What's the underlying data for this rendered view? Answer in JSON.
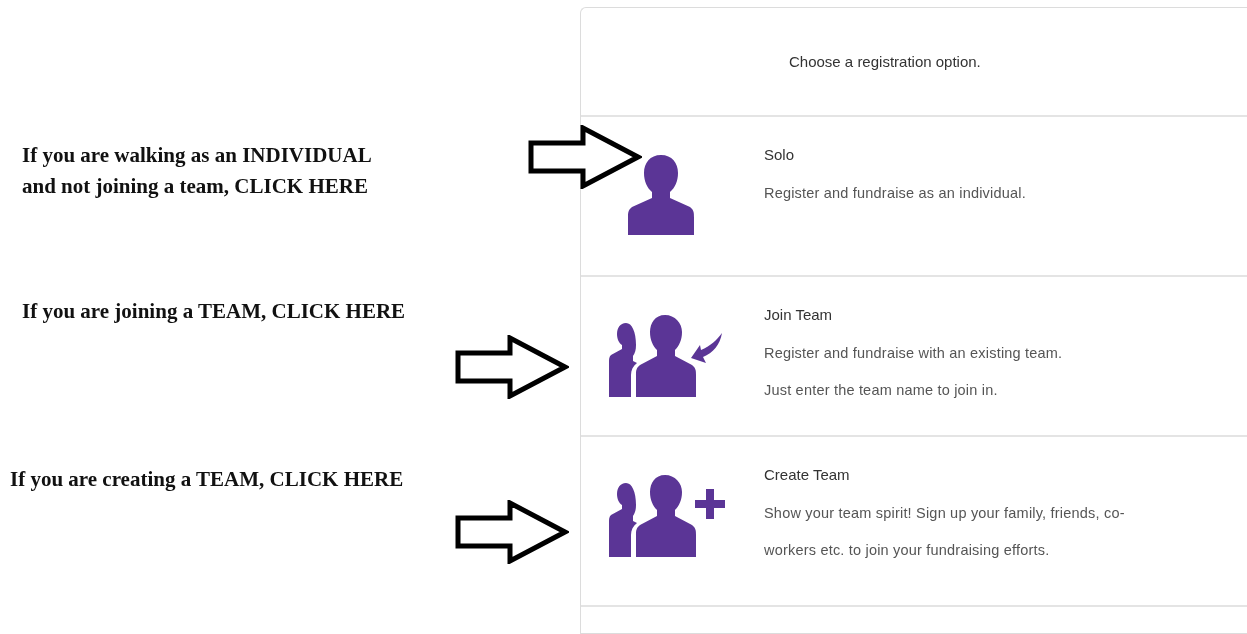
{
  "prompt": "Choose a registration option.",
  "options": [
    {
      "kind": "solo",
      "title": "Solo",
      "paragraphs": [
        "Register and fundraise as an individual."
      ]
    },
    {
      "kind": "join",
      "title": "Join Team",
      "paragraphs": [
        "Register and fundraise with an existing team.",
        "Just enter the team name to join in."
      ]
    },
    {
      "kind": "create",
      "title": "Create Team",
      "paragraphs": [
        "Show your team spirit! Sign up your family, friends, co-workers etc. to join your fundraising efforts."
      ]
    }
  ],
  "annotations": [
    {
      "lines": [
        "If you are walking as an INDIVIDUAL",
        "and not joining a team, CLICK HERE"
      ]
    },
    {
      "lines": [
        "If you are joining a TEAM, CLICK HERE"
      ]
    },
    {
      "lines": [
        "If you are creating a TEAM, CLICK HERE"
      ]
    }
  ]
}
